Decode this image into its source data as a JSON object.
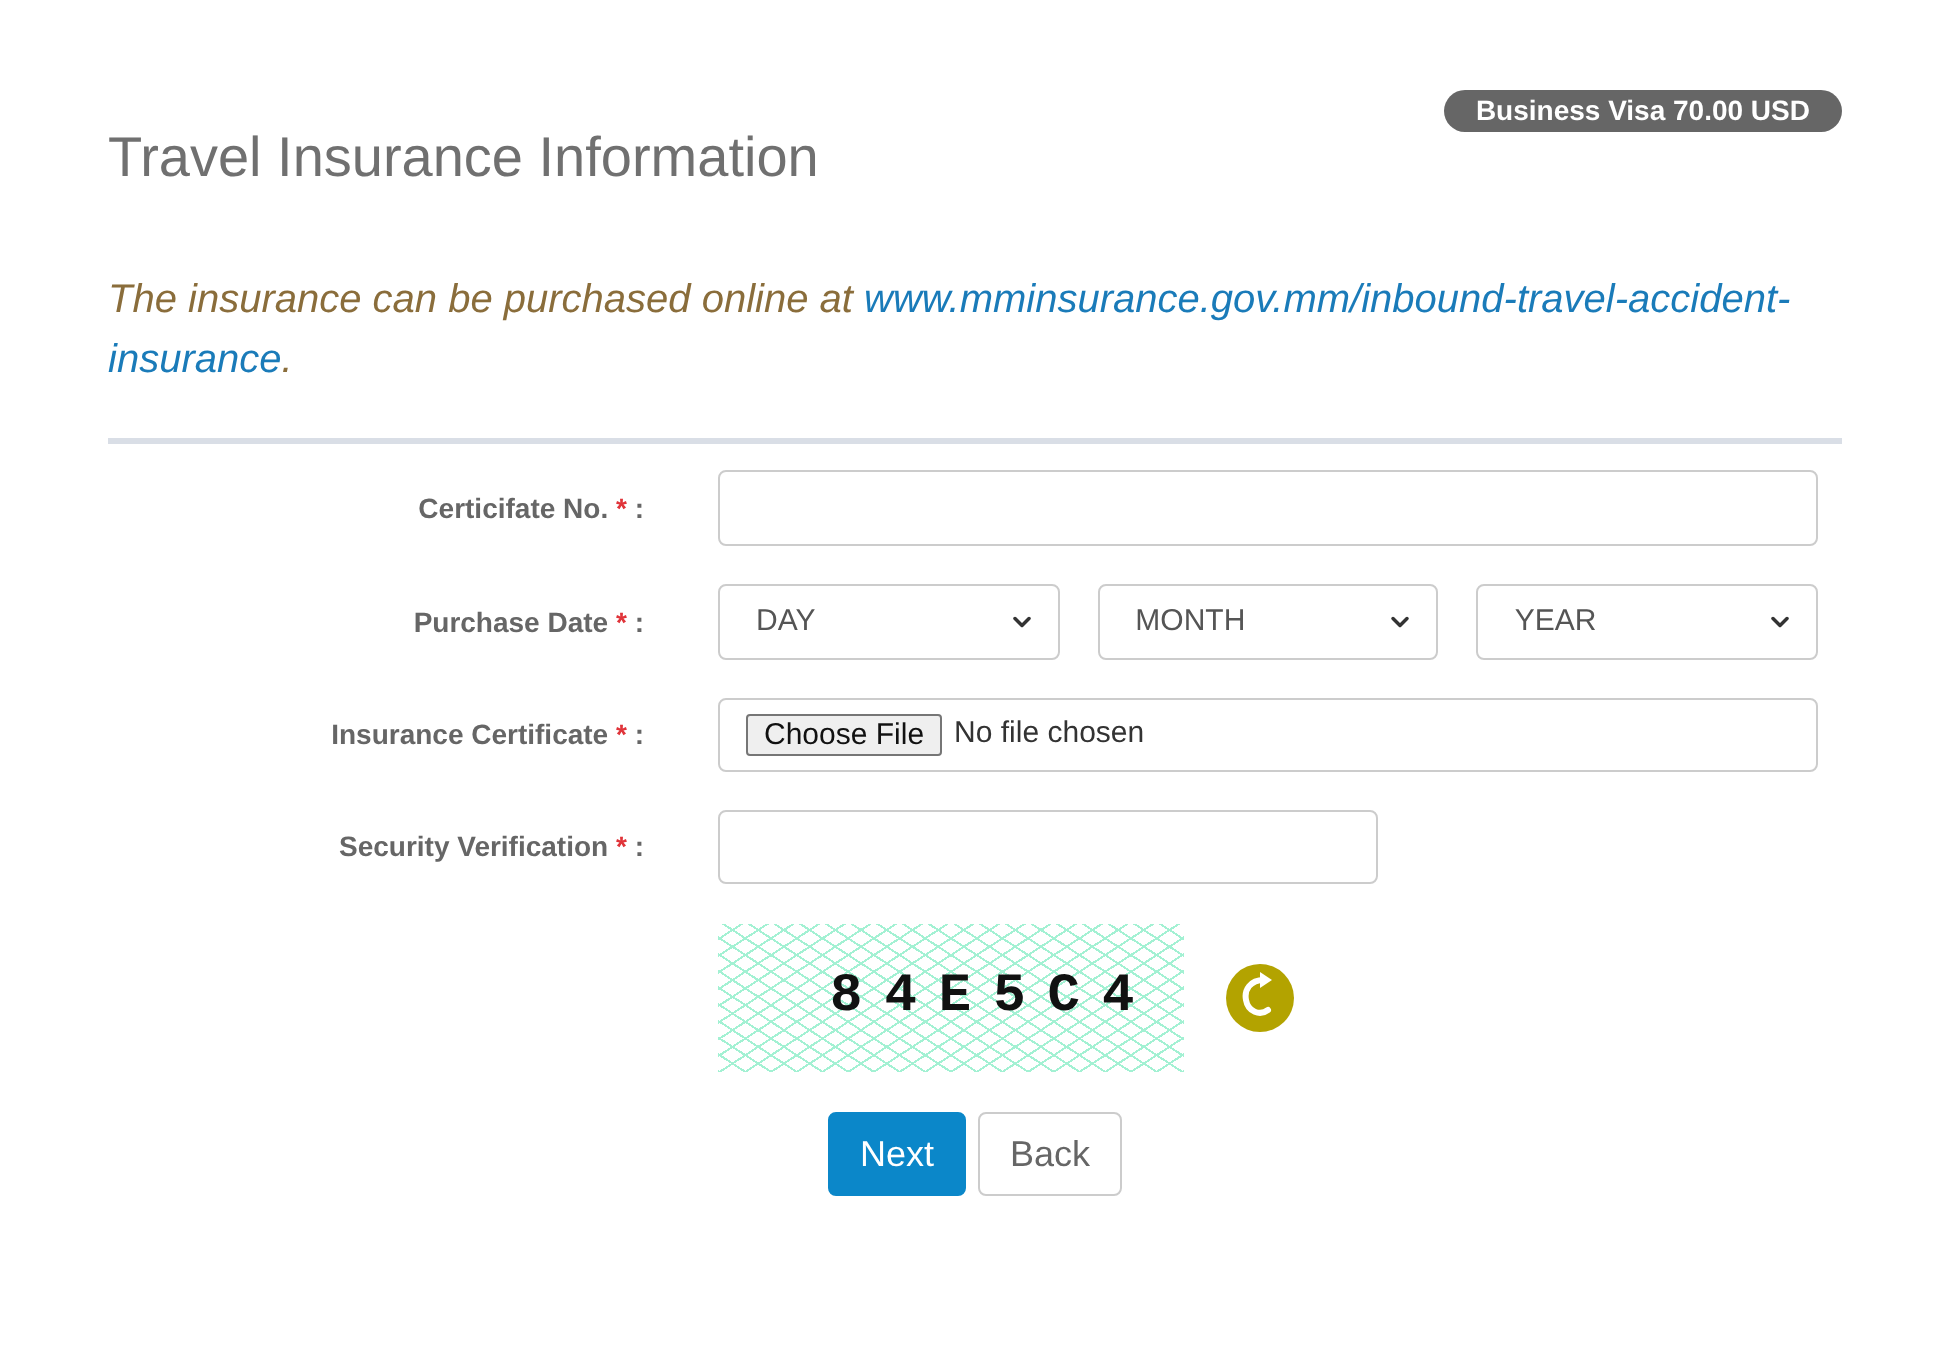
{
  "badge": {
    "text": "Business Visa 70.00 USD"
  },
  "title": "Travel Insurance Information",
  "notice": {
    "text": "The insurance can be purchased online at ",
    "link_lines": [
      "www.mminsurance.gov.mm/inbound-travel-accident-",
      "insurance"
    ],
    "end": "."
  },
  "form": {
    "fields": [
      {
        "kind": "text",
        "label": "Certicifate No.",
        "required_mark": "*",
        "colon": ":"
      },
      {
        "kind": "date",
        "label": "Purchase Date",
        "required_mark": "*",
        "colon": ":",
        "selects": [
          "DAY",
          "MONTH",
          "YEAR"
        ]
      },
      {
        "kind": "file",
        "label": "Insurance Certificate",
        "required_mark": "*",
        "colon": ":",
        "button": "Choose File",
        "status": "No file chosen"
      },
      {
        "kind": "captcha_input",
        "label": "Security Verification",
        "required_mark": "*",
        "colon": ":"
      }
    ],
    "captcha": {
      "text": "84E5C4"
    }
  },
  "buttons": [
    {
      "kind": "primary",
      "label": "Next"
    },
    {
      "kind": "default",
      "label": "Back"
    }
  ]
}
